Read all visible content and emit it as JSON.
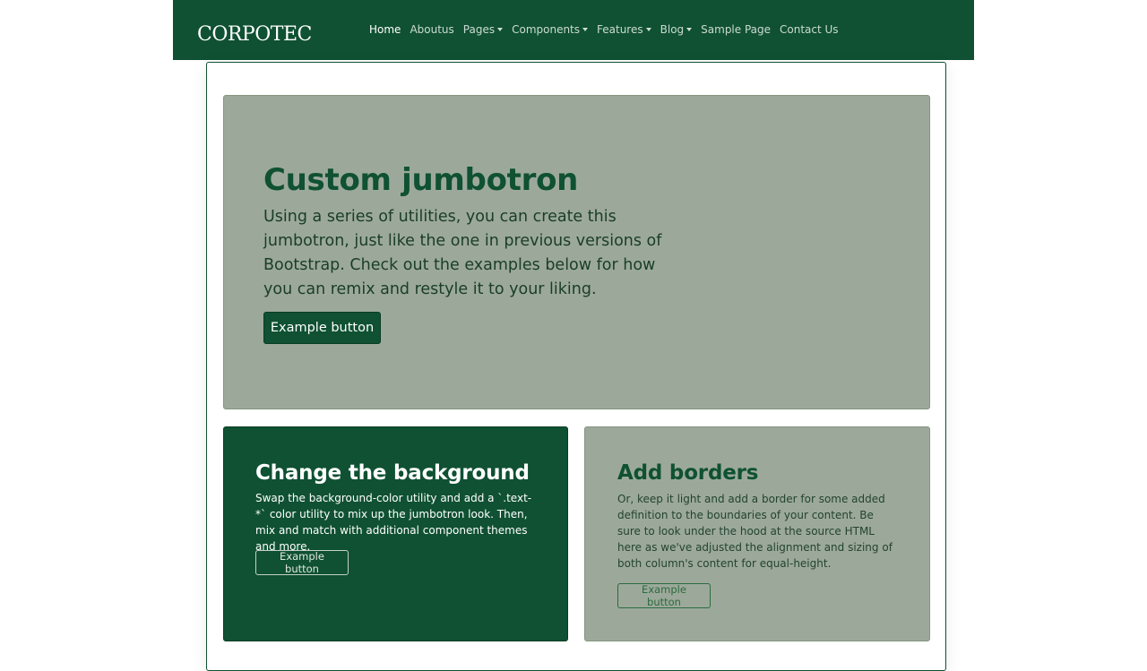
{
  "navbar": {
    "brand": "CORPOTEC",
    "links": [
      {
        "label": "Home"
      },
      {
        "label": "Aboutus"
      },
      {
        "label": "Pages"
      },
      {
        "label": "Components"
      },
      {
        "label": "Features"
      },
      {
        "label": "Blog"
      },
      {
        "label": "Sample Page"
      },
      {
        "label": "Contact Us"
      }
    ]
  },
  "jumbotron": {
    "title": "Custom jumbotron",
    "text": "Using a series of utilities, you can create this jumbotron, just like the one in previous versions of Bootstrap. Check out the examples below for how you can remix and restyle it to your liking.",
    "button": "Example button"
  },
  "cards": [
    {
      "title": "Change the background",
      "text": "Swap the background-color utility and add a `.text-*` color utility to mix up the jumbotron look. Then, mix and match with additional component themes and more.",
      "button": "Example button"
    },
    {
      "title": "Add borders",
      "text": "Or, keep it light and add a border for some added definition to the boundaries of your content. Be sure to look under the hood at the source HTML here as we've adjusted the alignment and sizing of both column's content for equal-height.",
      "button": "Example button"
    }
  ],
  "colors": {
    "brand": "#0f5132",
    "muted_panel": "#9ca99a"
  }
}
